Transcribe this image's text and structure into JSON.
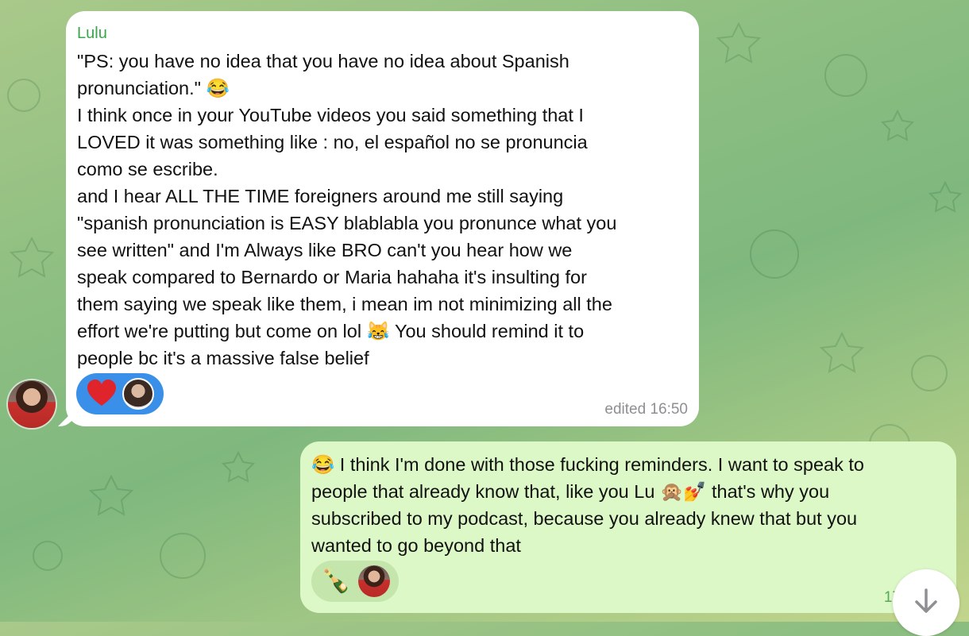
{
  "incoming": {
    "sender": "Lulu",
    "text_line1": "\"PS: you have no idea that you have no idea about Spanish",
    "text_line2": "pronunciation.\" 😂",
    "text_body": "I think once in your YouTube videos you said something that I\nLOVED it was something like : no, el español no se pronuncia\ncomo se escribe.\nand I hear ALL THE TIME foreigners around me still saying\n\"spanish pronunciation is EASY blablabla you pronunce what you\nsee written\" and I'm Always like BRO can't you hear how we\nspeak compared to Bernardo or Maria hahaha it's insulting for\nthem saying we speak like them,  i mean im not minimizing all the\neffort we're putting but come on lol 😹 You should remind it to\npeople bc it's a massive false belief",
    "time": "edited 16:50",
    "reaction_icon": "heart-icon"
  },
  "outgoing": {
    "text": "😂 I think I'm done with those fucking reminders. I want to speak to\npeople that already know that, like you Lu 🙊💅 that's why you\nsubscribed to my podcast, because you already knew that but you\nwanted to go beyond that",
    "reaction_emoji": "🍾",
    "time": "17"
  },
  "colors": {
    "sender": "#3aa54a",
    "reaction_bg": "#3a8fe8",
    "outgoing_bg": "#dcf8c6"
  }
}
